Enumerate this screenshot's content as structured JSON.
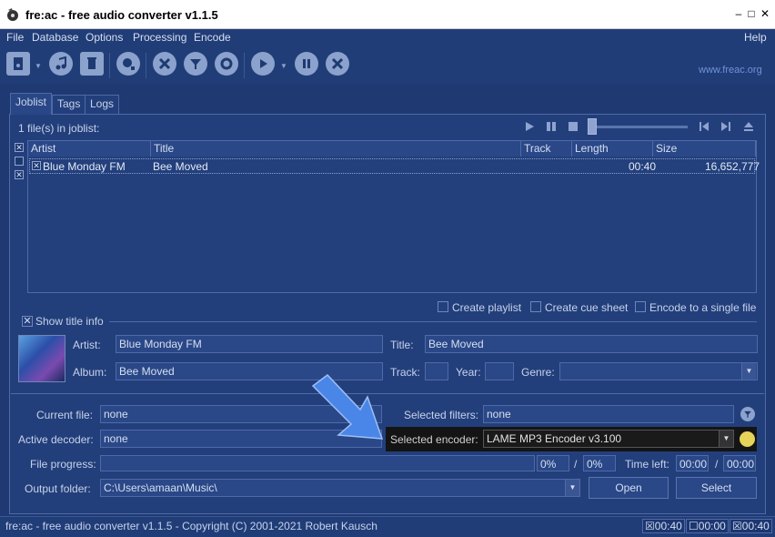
{
  "window": {
    "title": "fre:ac - free audio converter v1.1.5"
  },
  "menu": [
    "File",
    "Database",
    "Options",
    "Processing",
    "Encode",
    "Help"
  ],
  "toolbar": {
    "website": "www.freac.org"
  },
  "tabs": [
    "Joblist",
    "Tags",
    "Logs"
  ],
  "joblist": {
    "count_label": "1 file(s) in joblist:",
    "columns": [
      "Artist",
      "Title",
      "Track",
      "Length",
      "Size"
    ],
    "rows": [
      {
        "artist": "Blue Monday FM",
        "title": "Bee Moved",
        "track": "",
        "length": "00:40",
        "size": "16,652,777"
      }
    ]
  },
  "options": {
    "create_playlist": "Create playlist",
    "create_cue_sheet": "Create cue sheet",
    "encode_single": "Encode to a single file"
  },
  "title_info": {
    "header": "Show title info",
    "artist_label": "Artist:",
    "artist": "Blue Monday FM",
    "title_label": "Title:",
    "title": "Bee Moved",
    "album_label": "Album:",
    "album": "Bee Moved",
    "track_label": "Track:",
    "track": "",
    "year_label": "Year:",
    "year": "",
    "genre_label": "Genre:",
    "genre": ""
  },
  "status": {
    "current_file_label": "Current file:",
    "current_file": "none",
    "selected_filters_label": "Selected filters:",
    "selected_filters": "none",
    "active_decoder_label": "Active decoder:",
    "active_decoder": "none",
    "selected_encoder_label": "Selected encoder:",
    "selected_encoder": "LAME MP3 Encoder v3.100",
    "file_progress_label": "File progress:",
    "file_progress": "0%",
    "total_progress": "0%",
    "time_left_label": "Time left:",
    "time_left": "00:00",
    "time_total": "00:00",
    "slash": "/",
    "output_folder_label": "Output folder:",
    "output_folder": "C:\\Users\\amaan\\Music\\",
    "open_button": "Open",
    "select_button": "Select"
  },
  "statusbar": {
    "text": "fre:ac - free audio converter v1.1.5 - Copyright (C) 2001-2021 Robert Kausch",
    "t1": "00:40",
    "t2": "00:00",
    "t3": "00:40"
  },
  "colors": {
    "background": "#1f3a72",
    "accent": "#6e92d6",
    "arrow": "#4a86e8"
  }
}
